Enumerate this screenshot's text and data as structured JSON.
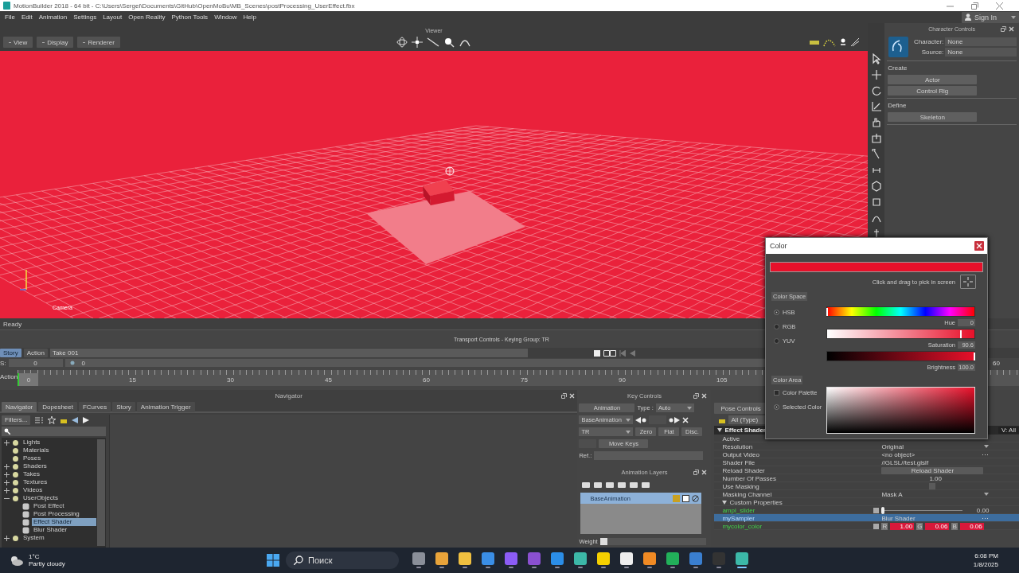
{
  "window": {
    "title": "MotionBuilder 2018 - 64 bit - C:\\Users\\Sergei\\Documents\\GitHub\\OpenMoBu\\MB_Scenes\\postProcessing_UserEffect.fbx"
  },
  "menu": [
    "File",
    "Edit",
    "Animation",
    "Settings",
    "Layout",
    "Open Reality",
    "Python Tools",
    "Window",
    "Help"
  ],
  "account": {
    "label": "Sign In"
  },
  "viewer": {
    "title": "Viewer",
    "menus": [
      "View",
      "Display",
      "Renderer"
    ],
    "camera": "Camera",
    "status": "Ready"
  },
  "character_controls": {
    "title": "Character Controls",
    "fields": [
      {
        "label": "Character:",
        "value": "None"
      },
      {
        "label": "Source:",
        "value": "None"
      }
    ],
    "sections": [
      {
        "title": "Create",
        "buttons": [
          "Actor",
          "Control Rig"
        ]
      },
      {
        "title": "Define",
        "buttons": [
          "Skeleton"
        ]
      }
    ]
  },
  "transport": {
    "title": "Transport Controls  -  Keying Group: TR",
    "modes": [
      {
        "label": "Story",
        "selected": true
      },
      {
        "label": "Action",
        "selected": false
      }
    ],
    "take": "Take 001",
    "start_label": "S:",
    "start": "0",
    "current": "0",
    "end": "60",
    "timeline_label": "Action",
    "frame": "0",
    "ticks": [
      "15",
      "30",
      "45",
      "60",
      "75",
      "90",
      "105"
    ]
  },
  "navigator": {
    "title": "Navigator",
    "tabs": [
      {
        "label": "Navigator",
        "selected": true
      },
      {
        "label": "Dopesheet",
        "selected": false
      },
      {
        "label": "FCurves",
        "selected": false
      },
      {
        "label": "Story",
        "selected": false
      },
      {
        "label": "Animation Trigger",
        "selected": false
      }
    ],
    "filters": "Filters...",
    "tree": [
      {
        "label": "Lights",
        "expanded": false,
        "selected": false
      },
      {
        "label": "Materials",
        "selected": false
      },
      {
        "label": "Poses",
        "selected": false
      },
      {
        "label": "Shaders",
        "expanded": false,
        "selected": false
      },
      {
        "label": "Takes",
        "expanded": false,
        "selected": false
      },
      {
        "label": "Textures",
        "expanded": false,
        "selected": false
      },
      {
        "label": "Videos",
        "expanded": false,
        "selected": false
      },
      {
        "label": "UserObjects",
        "expanded": true,
        "selected": false,
        "children": [
          {
            "label": "Post Effect",
            "selected": false
          },
          {
            "label": "Post Processing",
            "selected": false
          },
          {
            "label": "Effect Shader",
            "selected": true
          },
          {
            "label": "Blur Shader",
            "selected": false
          }
        ]
      },
      {
        "label": "System",
        "expanded": false,
        "selected": false
      }
    ]
  },
  "key_controls": {
    "title": "Key Controls",
    "mode_button": "Animation",
    "type_label": "Type :",
    "type": "Auto",
    "layer": "BaseAnimation",
    "keying_group": "TR",
    "interpolation": [
      "Zero",
      "Flat",
      "Disc."
    ],
    "move_keys": "Move Keys",
    "ref_label": "Ref.:"
  },
  "animation_layers": {
    "title": "Animation Layers",
    "layers": [
      {
        "name": "BaseAnimation",
        "selected": true
      }
    ],
    "weight": {
      "label": "Weight",
      "level": 0
    }
  },
  "properties": {
    "tab": "Pose Controls",
    "filter": "All (Type)",
    "object": "Effect Shader",
    "view": "V: All",
    "rows": [
      {
        "kind": "plain",
        "label": "Active",
        "custom": false,
        "selected": false
      },
      {
        "kind": "dropdown",
        "label": "Resolution",
        "value": "Original",
        "custom": false,
        "selected": false
      },
      {
        "kind": "object",
        "label": "Output Video",
        "value": "<no object>",
        "custom": false,
        "selected": false
      },
      {
        "kind": "text",
        "label": "Shader File",
        "value": "//GLSL//test.glslf",
        "custom": false,
        "selected": false
      },
      {
        "kind": "button",
        "label": "Reload Shader",
        "value": "Reload Shader",
        "custom": false,
        "selected": false
      },
      {
        "kind": "number",
        "label": "Number Of Passes",
        "value": "1.00",
        "custom": false,
        "selected": false
      },
      {
        "kind": "checkbox",
        "label": "Use Masking",
        "checked": false,
        "custom": false,
        "selected": false
      },
      {
        "kind": "dropdown",
        "label": "Masking Channel",
        "value": "Mask A",
        "custom": false,
        "selected": false
      },
      {
        "kind": "group",
        "label": "Custom Properties",
        "expanded": true,
        "custom": false,
        "selected": false
      },
      {
        "kind": "slider",
        "label": "ampl_slider",
        "level": 0,
        "value": "0.00",
        "custom": true,
        "selected": false
      },
      {
        "kind": "object",
        "label": "mySampler",
        "value": "Blur Shader",
        "custom": false,
        "selected": true
      },
      {
        "kind": "color",
        "label": "mycolor_color",
        "channels": [
          {
            "label": "R",
            "value": "1.00"
          },
          {
            "label": "G",
            "value": "0.06"
          },
          {
            "label": "B",
            "value": "0.06"
          }
        ],
        "custom": true,
        "selected": false
      }
    ]
  },
  "color_dialog": {
    "title": "Color",
    "color": "#e8102a",
    "pick_hint": "Click and drag to pick in screen",
    "space_title": "Color Space",
    "spaces": [
      {
        "label": "HSB",
        "selected": true
      },
      {
        "label": "RGB",
        "selected": false
      },
      {
        "label": "YUV",
        "selected": false
      }
    ],
    "sliders": [
      {
        "kind": "hue",
        "label": "Hue",
        "value": "0",
        "level": 0
      },
      {
        "kind": "saturation",
        "label": "Saturation",
        "value": "90.6",
        "level": 0.906
      },
      {
        "kind": "brightness",
        "label": "Brightness",
        "value": "100.0",
        "level": 1
      }
    ],
    "area_title": "Color Area",
    "areas": [
      {
        "label": "Color Palette",
        "selected": false
      },
      {
        "label": "Selected Color",
        "selected": true
      }
    ]
  },
  "taskbar": {
    "temperature": "1°C",
    "condition": "Partly cloudy",
    "search": "Поиск",
    "time": "6:08 PM",
    "date": "1/8/2025",
    "apps": [
      {
        "color": "#8a8f99",
        "active": false
      },
      {
        "color": "#e8a33a",
        "active": false
      },
      {
        "color": "#f0c040",
        "active": false
      },
      {
        "color": "#3a8ee6",
        "active": false
      },
      {
        "color": "#8b5cf6",
        "active": false
      },
      {
        "color": "#8a50d0",
        "active": false
      },
      {
        "color": "#2b8ee8",
        "active": false
      },
      {
        "color": "#3cb8a8",
        "active": false
      },
      {
        "color": "#f5d000",
        "active": false
      },
      {
        "color": "#eeeeee",
        "active": false
      },
      {
        "color": "#f08a24",
        "active": false
      },
      {
        "color": "#22b05a",
        "active": false
      },
      {
        "color": "#3a7fd0",
        "active": false
      },
      {
        "color": "#333333",
        "active": false
      },
      {
        "color": "#3cb8a8",
        "active": true
      }
    ]
  }
}
